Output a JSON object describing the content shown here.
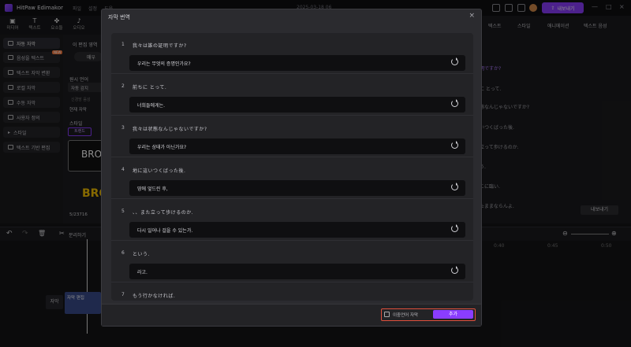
{
  "app": {
    "name": "HitPaw Edimakor",
    "menus": [
      "파일",
      "설정",
      "도움"
    ],
    "date": "2025-03-18 06",
    "export_label": "내보내기"
  },
  "toptools": [
    "미디어",
    "텍스트",
    "요소들",
    "오디오"
  ],
  "leftnav": [
    {
      "label": "자동 자막",
      "active": true
    },
    {
      "label": "음성을 텍스트",
      "badge": "NEW"
    },
    {
      "label": "텍스트 자막 변환"
    },
    {
      "label": "로컬 자막"
    },
    {
      "label": "수동 자막"
    },
    {
      "label": "사용자 정의"
    },
    {
      "label": "스타일"
    },
    {
      "label": "텍스트 기반 편집"
    }
  ],
  "midpanel": {
    "line1": "이 편집 영역",
    "btn": "매우",
    "section": "원시 언어",
    "auto": "자동 감지",
    "hint": "신경망 음성",
    "cur": "현재 자막",
    "style": "스타일",
    "trend": "트렌드",
    "preview1": "BRO",
    "preview2": "BRO",
    "credits": "5/23716"
  },
  "rightpanel": {
    "tabs": [
      "텍스트",
      "스타일",
      "애니메이션",
      "텍스트 음성"
    ],
    "rows": [
      "今何時ですか?",
      "の証明ですか?",
      "前ちに とって.",
      "ま状態なんじゃないですか?",
      "で臨いつくばった後.",
      "また立って歩けるのか.",
      "という.",
      "もう行かなければ.",
      "がそこに臨い.",
      "ばったままならんよ."
    ],
    "export_btn": "내보내기"
  },
  "timeline": {
    "cut": "분리하기",
    "ticks": [
      "0:40",
      "0:45",
      "0:50"
    ],
    "track_label": "자막",
    "clip": "자막 편집"
  },
  "dialog": {
    "title": "자막 번역",
    "close": "×",
    "segments": [
      {
        "num": "1",
        "source": "我々は誰の証明ですか?",
        "translation": "우리는 무엇의 증명인가요?"
      },
      {
        "num": "2",
        "source": "前ちに とって.",
        "translation": "너희들에게는."
      },
      {
        "num": "3",
        "source": "我々は状態なんじゃないですか?",
        "translation": "우리는 상태가 아닌가요?"
      },
      {
        "num": "4",
        "source": "地に這いつくばった後.",
        "translation": "땅에 엎드린 후,"
      },
      {
        "num": "5",
        "source": "、、また立って歩けるのか.",
        "translation": "다시 일어나 걸을 수 있는가."
      },
      {
        "num": "6",
        "source": "という.",
        "translation": "라고."
      },
      {
        "num": "7",
        "source": "もう行かなければ.",
        "translation": ""
      }
    ],
    "footer": {
      "checkbox_label": "이중언어 자막",
      "add_label": "추가"
    }
  }
}
